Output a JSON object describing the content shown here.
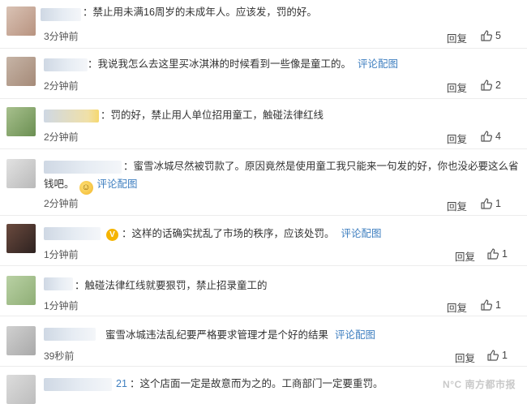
{
  "comments": [
    {
      "text": "：禁止用未满16周岁的未成年人。应该发，罚的好。",
      "link": "",
      "time": "3分钟前",
      "reply": "回复",
      "likes": "5",
      "has_emoji": false,
      "has_badge": false,
      "ucount": ""
    },
    {
      "text": "：我说我怎么去这里买冰淇淋的时候看到一些像是童工的。",
      "link": "评论配图",
      "time": "2分钟前",
      "reply": "回复",
      "likes": "2",
      "has_emoji": false,
      "has_badge": false,
      "ucount": ""
    },
    {
      "text": "：罚的好，禁止用人单位招用童工，触碰法律红线",
      "link": "",
      "time": "2分钟前",
      "reply": "回复",
      "likes": "4",
      "has_emoji": false,
      "has_badge": false,
      "ucount": ""
    },
    {
      "text": "：蜜雪冰城尽然被罚款了。原因竟然是使用童工我只能来一句发的好，你也没必要这么省",
      "text2": "钱吧。",
      "link": "评论配图",
      "time": "2分钟前",
      "reply": "回复",
      "likes": "1",
      "has_emoji": true,
      "has_badge": false,
      "ucount": ""
    },
    {
      "text": "：这样的话确实扰乱了市场的秩序，应该处罚。",
      "link": "评论配图",
      "time": "1分钟前",
      "reply": "回复",
      "likes": "1",
      "has_emoji": false,
      "has_badge": true,
      "ucount": ""
    },
    {
      "text": "：触碰法律红线就要狠罚，禁止招录童工的",
      "link": "",
      "time": "1分钟前",
      "reply": "回复",
      "likes": "1",
      "has_emoji": false,
      "has_badge": false,
      "ucount": ""
    },
    {
      "text": "蜜雪冰城违法乱纪要严格要求管理才是个好的结果",
      "link": "评论配图",
      "time": "39秒前",
      "reply": "回复",
      "likes": "1",
      "has_emoji": false,
      "has_badge": false,
      "ucount": ""
    },
    {
      "text": "：这个店面一定是故意而为之的。工商部门一定要重罚。",
      "link": "",
      "time": "",
      "reply": "",
      "likes": "",
      "has_emoji": false,
      "has_badge": false,
      "ucount": "21"
    }
  ],
  "badge_symbol": "V",
  "emoji_symbol": "☺",
  "watermark": "N°C 南方都市报"
}
